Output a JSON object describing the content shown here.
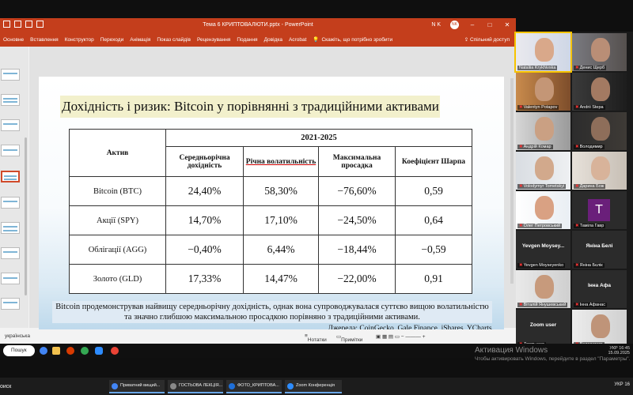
{
  "ppt": {
    "window_title": "Тема 6 КРИПТОВАЛЮТИ.pptx  -  PowerPoint",
    "user_initials": "NK",
    "user_name": "N K",
    "ribbon_tabs": [
      "Основне",
      "Вставлення",
      "Конструктор",
      "Переходи",
      "Анімація",
      "Показ слайдів",
      "Рецензування",
      "Подання",
      "Довідка",
      "Acrobat"
    ],
    "tell_me": "Скажіть, що потрібно зробити",
    "share": "Спільний доступ",
    "status_lang": "українська",
    "status_notes": "Нотатки",
    "status_comments": "Примітки"
  },
  "slide": {
    "title": "Дохідність і ризик: Bitcoin у порівнянні з традиційними активами",
    "period": "2021-2025",
    "headers": {
      "asset": "Актив",
      "avg_return": "Середньорічна дохідність",
      "volatility": "Річна волатильність",
      "drawdown": "Максимальна просадка",
      "sharpe": "Коефіцієнт Шарпа"
    },
    "rows": [
      {
        "asset": "Bitcoin (BTC)",
        "avg_return": "24,40%",
        "volatility": "58,30%",
        "drawdown": "−76,60%",
        "sharpe": "0,59"
      },
      {
        "asset": "Акції (SPY)",
        "avg_return": "14,70%",
        "volatility": "17,10%",
        "drawdown": "−24,50%",
        "sharpe": "0,64"
      },
      {
        "asset": "Облігації (AGG)",
        "avg_return": "−0,40%",
        "volatility": "6,44%",
        "drawdown": "−18,44%",
        "sharpe": "−0,59"
      },
      {
        "asset": "Золото (GLD)",
        "avg_return": "17,33%",
        "volatility": "14,47%",
        "drawdown": "−22,00%",
        "sharpe": "0,91"
      }
    ],
    "note": "Bitcoin продемонстрував найвищу середньорічну дохідність, однак вона супроводжувалася суттєво вищою волатильністю та значно глибшою максимальною просадкою порівняно з традиційними активами.",
    "source": "Джерела: CoinGecko, Gale Finance, iShares, YCharts."
  },
  "zoom": {
    "participants": [
      {
        "name": "Nataliia Krykhivska",
        "muted": false
      },
      {
        "name": "Денис Щерб",
        "muted": true
      },
      {
        "name": "Valentyn Potapov",
        "muted": true
      },
      {
        "name": "Andrii Stepa",
        "muted": true
      },
      {
        "name": "Андрій Комар",
        "muted": true
      },
      {
        "name": "Володимир",
        "muted": true
      },
      {
        "name": "Volodymyr Tometskyi",
        "muted": true
      },
      {
        "name": "Дарина Бож",
        "muted": true
      },
      {
        "name": "Олег Петровський",
        "muted": true
      },
      {
        "name": "Таміла Гавр",
        "muted": true
      },
      {
        "name": "Yevgen Moysey...",
        "sub": "Yevgen Moyseyenko",
        "muted": true
      },
      {
        "name": "Яніна Белі",
        "sub": "Яніна Бєлік",
        "muted": true
      },
      {
        "name": "Віталій Янушевський",
        "muted": true
      },
      {
        "name": "Інна Афа",
        "sub": "Інна Афанас",
        "muted": true
      },
      {
        "name": "Zoom user",
        "sub": "Zoom user",
        "muted": true
      },
      {
        "name": "Володимир",
        "muted": true
      }
    ],
    "tamila_initial": "T"
  },
  "os": {
    "search": "Пошук",
    "search_left": "оиск",
    "activate_title": "Активация Windows",
    "activate_sub": "Чтобы активировать Windows, перейдите в раздел \"Параметры\".",
    "lang": "УКР",
    "time": "16:45",
    "date": "15.09.2025",
    "tasks": [
      "Приватний вищий...",
      "ГОСТЬОВА ЛЕКЦІЯ...",
      "ФОТО_КРИПТОВА...",
      "Zoom Конференція"
    ],
    "tray_lang2": "УКР",
    "time2": "16"
  }
}
